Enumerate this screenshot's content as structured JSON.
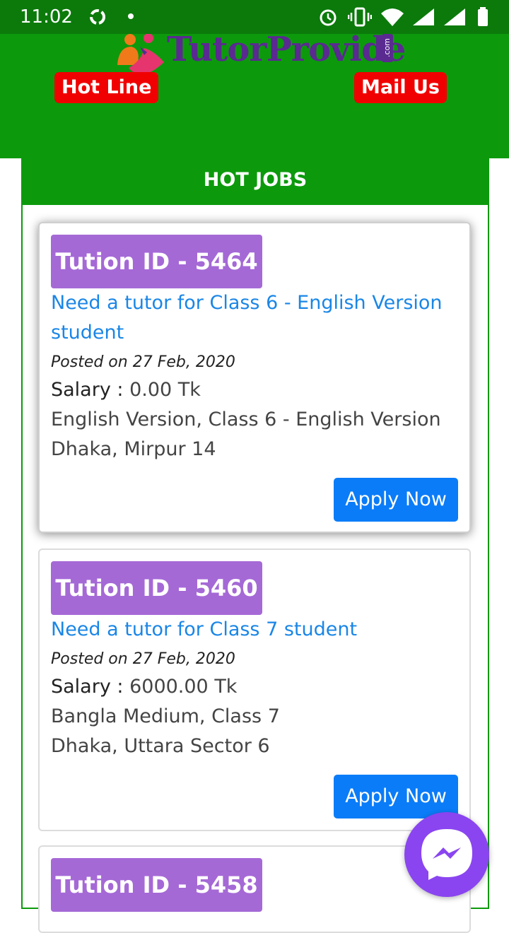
{
  "status_bar": {
    "time": "11:02"
  },
  "brand": {
    "name": "TutorProvide",
    "suffix": ".com"
  },
  "header": {
    "hotline_label": "Hot Line",
    "mail_label": "Mail Us"
  },
  "social_icons": [
    "phone-icon",
    "facebook-icon",
    "youtube-icon",
    "linkedin-icon",
    "instagram-icon",
    "twitter-icon",
    "envelope-icon"
  ],
  "section": {
    "title": "HOT JOBS"
  },
  "jobs": [
    {
      "id_label": "Tution ID - 5464",
      "title_line1": "Need a tutor for Class 6 - English Version",
      "title_line2": "student",
      "posted": "Posted on 27 Feb, 2020",
      "salary_label": "Salary :",
      "salary_value": " 0.00 Tk",
      "medium": "English Version, Class 6 - English Version",
      "location": "Dhaka, Mirpur 14",
      "apply_label": "Apply Now"
    },
    {
      "id_label": "Tution ID - 5460",
      "title_line1": "Need a tutor for Class 7 student",
      "posted": "Posted on 27 Feb, 2020",
      "salary_label": "Salary :",
      "salary_value": " 6000.00 Tk",
      "medium": "Bangla Medium, Class 7",
      "location": "Dhaka, Uttara Sector 6",
      "apply_label": "Apply Now"
    },
    {
      "id_label": "Tution ID - 5458"
    }
  ],
  "colors": {
    "header_green": "#0c9a0c",
    "status_green": "#0b7a0b",
    "pill_red": "#f00000",
    "tid_purple": "#a569d6",
    "link_blue": "#1a86e6",
    "button_blue": "#0a7cf8",
    "messenger_purple": "#8a45f0"
  }
}
